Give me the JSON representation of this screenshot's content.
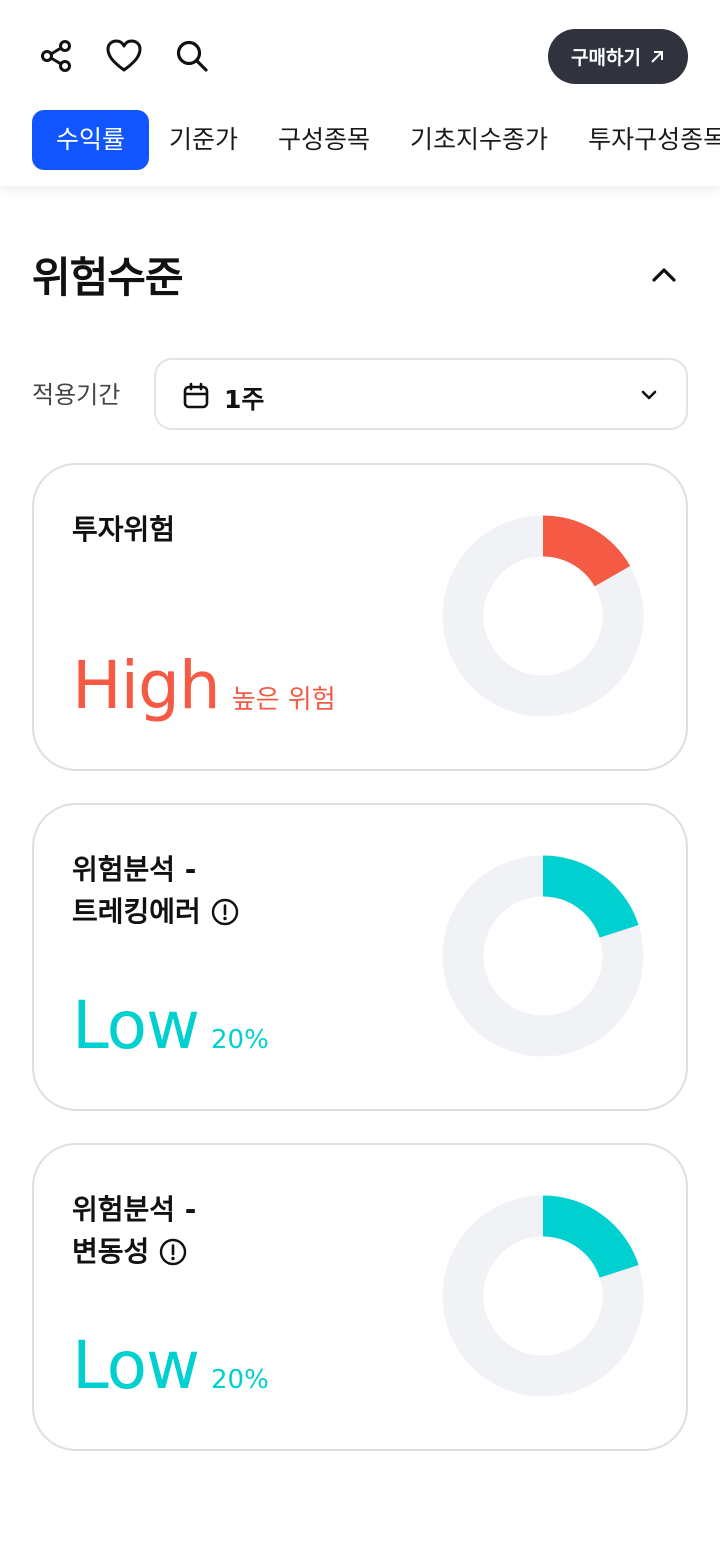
{
  "header": {
    "buy_label": "구매하기",
    "tabs": [
      "수익률",
      "기준가",
      "구성종목",
      "기초지수종가",
      "투자구성종목"
    ]
  },
  "section": {
    "title": "위험수준",
    "period_label": "적용기간",
    "period_value": "1주"
  },
  "cards": [
    {
      "title_line1": "투자위험",
      "title_line2": "",
      "has_info": false,
      "level": "High",
      "sub": "높은 위험",
      "color": "#f45a44",
      "fraction": 0.167
    },
    {
      "title_line1": "위험분석 -",
      "title_line2": "트레킹에러",
      "has_info": true,
      "level": "Low",
      "sub": "20%",
      "color": "#00d0cf",
      "fraction": 0.2
    },
    {
      "title_line1": "위험분석 -",
      "title_line2": "변동성",
      "has_info": true,
      "level": "Low",
      "sub": "20%",
      "color": "#00d0cf",
      "fraction": 0.2
    }
  ],
  "colors": {
    "accent_blue": "#1155ff",
    "dark_button": "#30333d",
    "donut_track": "#f1f2f6"
  }
}
